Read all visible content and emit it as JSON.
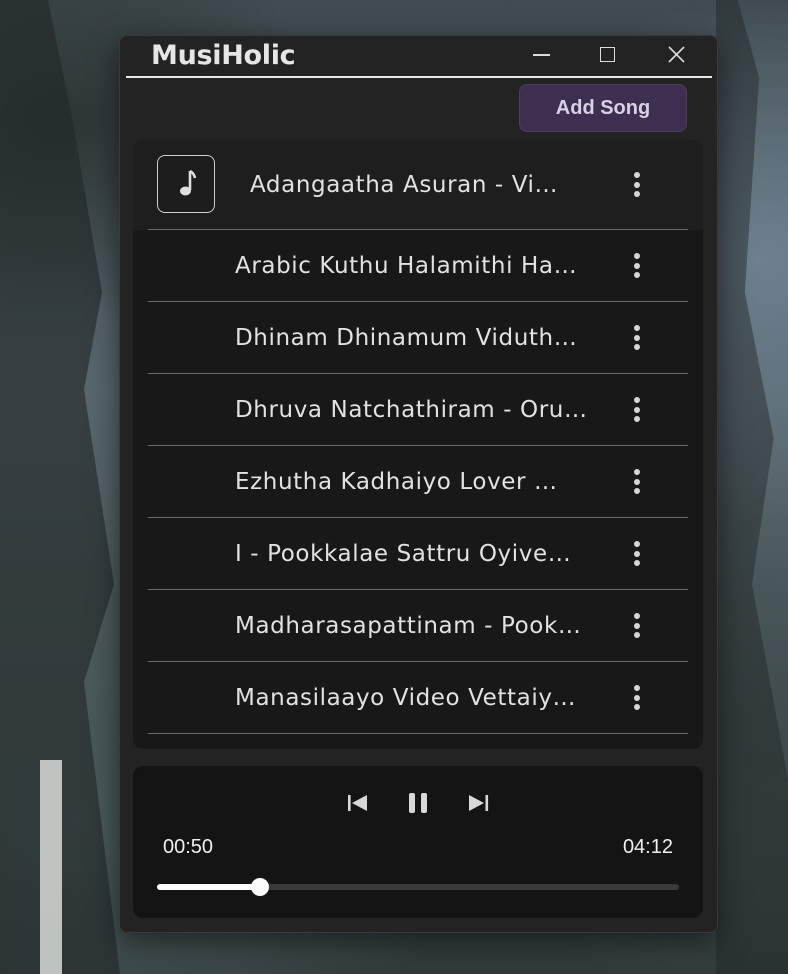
{
  "app": {
    "title": "MusiHolic"
  },
  "window_controls": {
    "minimize": "minimize-icon",
    "maximize": "maximize-icon",
    "close": "close-icon"
  },
  "toolbar": {
    "add_song_label": "Add Song",
    "accent": "#3c2f50"
  },
  "songs": [
    {
      "title": "Adangaatha Asuran - Vi…",
      "active": true
    },
    {
      "title": "Arabic Kuthu  Halamithi Ha…",
      "active": false
    },
    {
      "title": "Dhinam Dhinamum  Viduth…",
      "active": false
    },
    {
      "title": "Dhruva Natchathiram - Oru…",
      "active": false
    },
    {
      "title": "Ezhutha Kadhaiyo  Lover  …",
      "active": false
    },
    {
      "title": "I - Pookkalae Sattru Oyive…",
      "active": false
    },
    {
      "title": "Madharasapattinam - Pook…",
      "active": false
    },
    {
      "title": "Manasilaayo Video  Vettaiy…",
      "active": false
    }
  ],
  "player": {
    "current_time": "00:50",
    "total_time": "04:12",
    "progress_fraction": 0.198,
    "icons": {
      "previous": "skip-previous-icon",
      "pause": "pause-icon",
      "next": "skip-next-icon"
    }
  }
}
